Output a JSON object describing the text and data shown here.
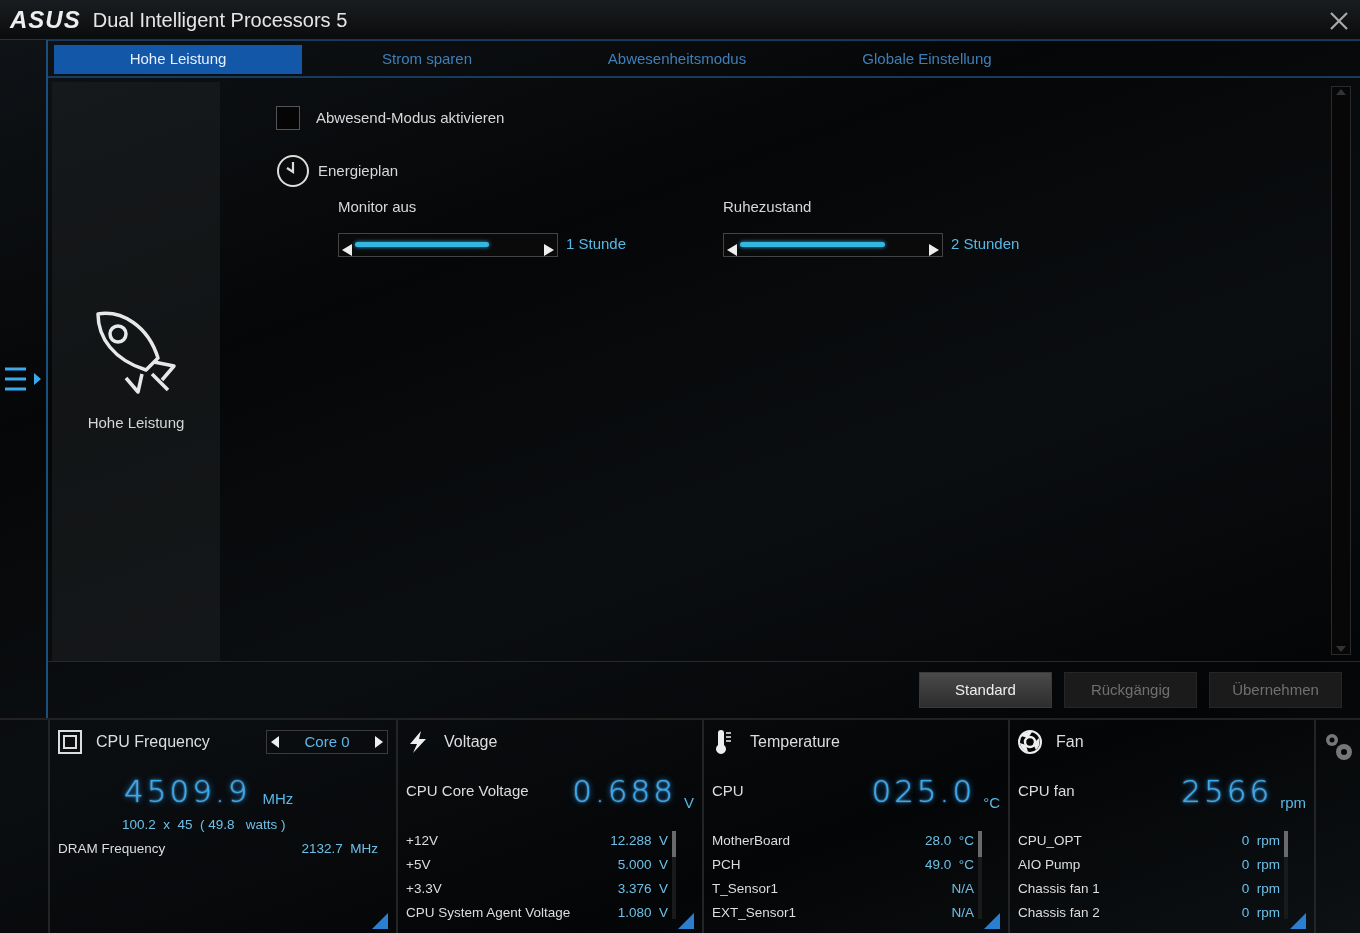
{
  "window": {
    "logo": "ASUS",
    "title": "Dual Intelligent Processors 5"
  },
  "tabs": [
    {
      "label": "Hohe Leistung",
      "selected": true
    },
    {
      "label": "Strom sparen",
      "selected": false
    },
    {
      "label": "Abwesenheitsmodus",
      "selected": false
    },
    {
      "label": "Globale Einstellung",
      "selected": false
    }
  ],
  "mode_panel": {
    "label": "Hohe Leistung"
  },
  "away_checkbox": {
    "label": "Abwesend-Modus aktivieren",
    "checked": false
  },
  "energy_plan": {
    "title": "Energieplan",
    "sliders": [
      {
        "label": "Monitor aus",
        "level": 0.72,
        "reading": "1 Stunde"
      },
      {
        "label": "Ruhezustand",
        "level": 0.78,
        "reading": "2 Stunden"
      }
    ]
  },
  "buttons": [
    {
      "label": "Standard",
      "disabled": false
    },
    {
      "label": "Rückgängig",
      "disabled": true
    },
    {
      "label": "Übernehmen",
      "disabled": true
    }
  ],
  "panels": [
    {
      "kind": "frequency",
      "title": "CPU Frequency",
      "selector": "Core 0",
      "main": {
        "value": "4509.9",
        "unit": "MHz"
      },
      "detail": "100.2  x  45  ( 49.8   watts )",
      "rows": [
        {
          "label": "DRAM Frequency",
          "value": "2132.7",
          "unit": "MHz"
        }
      ]
    },
    {
      "kind": "voltage",
      "title": "Voltage",
      "main": {
        "label": "CPU Core Voltage",
        "value": "0.688",
        "unit": "V"
      },
      "rows": [
        {
          "label": "+12V",
          "value": "12.288",
          "unit": "V"
        },
        {
          "label": "+5V",
          "value": "5.000",
          "unit": "V"
        },
        {
          "label": "+3.3V",
          "value": "3.376",
          "unit": "V"
        },
        {
          "label": "CPU System Agent Voltage",
          "value": "1.080",
          "unit": "V"
        }
      ]
    },
    {
      "kind": "temperature",
      "title": "Temperature",
      "main": {
        "label": "CPU",
        "value": "025.0",
        "unit": "°C"
      },
      "rows": [
        {
          "label": "MotherBoard",
          "value": "28.0",
          "unit": "°C"
        },
        {
          "label": "PCH",
          "value": "49.0",
          "unit": "°C"
        },
        {
          "label": "T_Sensor1",
          "value": "N/A"
        },
        {
          "label": "EXT_Sensor1",
          "value": "N/A"
        }
      ]
    },
    {
      "kind": "fan",
      "title": "Fan",
      "main": {
        "label": "CPU fan",
        "value": "2566",
        "unit": "rpm"
      },
      "rows": [
        {
          "label": "CPU_OPT",
          "value": "0",
          "unit": "rpm"
        },
        {
          "label": "AIO Pump",
          "value": "0",
          "unit": "rpm"
        },
        {
          "label": "Chassis fan 1",
          "value": "0",
          "unit": "rpm"
        },
        {
          "label": "Chassis fan 2",
          "value": "0",
          "unit": "rpm"
        }
      ]
    }
  ]
}
